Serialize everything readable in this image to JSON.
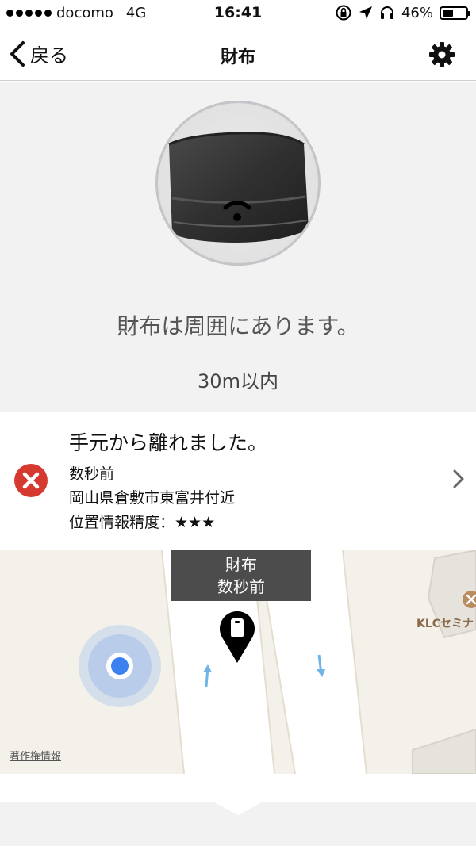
{
  "status_bar": {
    "carrier": "docomo",
    "network": "4G",
    "time": "16:41",
    "battery_percent": "46%",
    "battery_level": 0.46,
    "icons": [
      "orientation-lock-icon",
      "location-arrow-icon",
      "headphones-icon",
      "battery-icon"
    ]
  },
  "nav": {
    "back_label": "戻る",
    "title": "財布",
    "settings_icon": "gear-icon"
  },
  "proximity": {
    "message": "財布は周囲にあります。",
    "range": "30m以内",
    "signal_icon": "wifi-signal-icon"
  },
  "alert": {
    "title": "手元から離れました。",
    "time": "数秒前",
    "location": "岡山県倉敷市東富井付近",
    "accuracy": "位置情報精度：★★★",
    "status_color": "#d6392f"
  },
  "map": {
    "callout_title": "財布",
    "callout_time": "数秒前",
    "poi_label": "KLCセミナ",
    "copyright": "著作権情報",
    "user_location_color": "#3b82f0",
    "pin_color": "#000000"
  }
}
